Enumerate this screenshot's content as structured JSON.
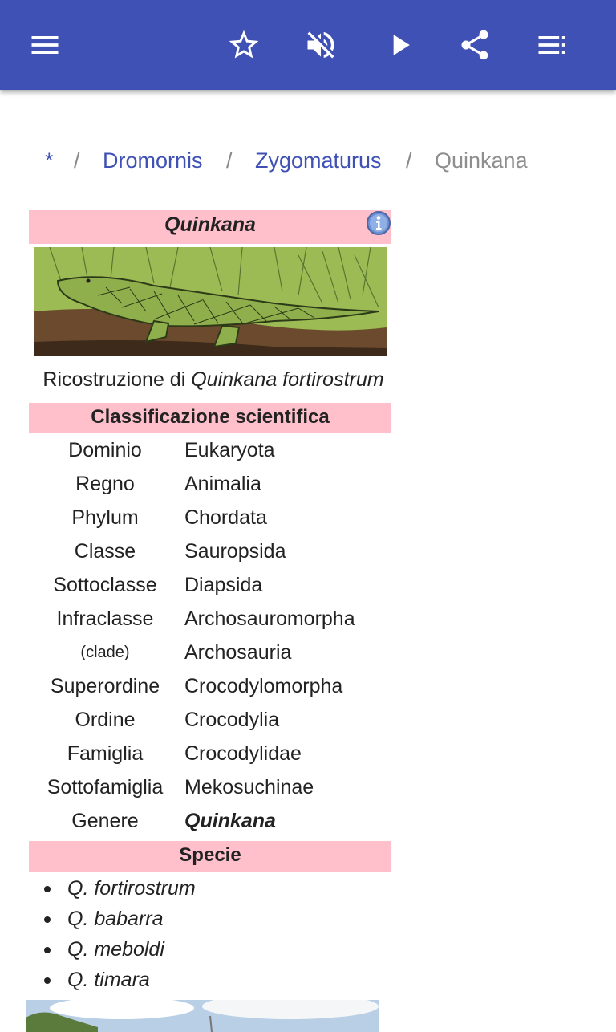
{
  "toolbar": {
    "icons": [
      "menu-icon",
      "star-outline-icon",
      "volume-off-icon",
      "play-icon",
      "share-icon",
      "playlist-icon"
    ]
  },
  "breadcrumb": {
    "items": [
      "*",
      "Dromornis",
      "Zygomaturus"
    ],
    "separator": "/",
    "current": "Quinkana"
  },
  "infobox": {
    "title": "Quinkana",
    "caption_prefix": "Ricostruzione di ",
    "caption_italic": "Quinkana fortirostrum",
    "classification_header": "Classificazione scientifica",
    "rows": [
      {
        "rank": "Dominio",
        "taxon": "Eukaryota"
      },
      {
        "rank": "Regno",
        "taxon": "Animalia"
      },
      {
        "rank": "Phylum",
        "taxon": "Chordata"
      },
      {
        "rank": "Classe",
        "taxon": "Sauropsida"
      },
      {
        "rank": "Sottoclasse",
        "taxon": "Diapsida"
      },
      {
        "rank": "Infraclasse",
        "taxon": "Archosauromorpha"
      },
      {
        "rank": "(clade)",
        "taxon": "Archosauria"
      },
      {
        "rank": "Superordine",
        "taxon": "Crocodylomorpha"
      },
      {
        "rank": "Ordine",
        "taxon": "Crocodylia"
      },
      {
        "rank": "Famiglia",
        "taxon": "Crocodylidae"
      },
      {
        "rank": "Sottofamiglia",
        "taxon": "Mekosuchinae"
      },
      {
        "rank": "Genere",
        "taxon": "Quinkana"
      }
    ],
    "species_header": "Specie",
    "species": [
      "Q. fortirostrum",
      "Q. babarra",
      "Q. meboldi",
      "Q. timara"
    ]
  },
  "colors": {
    "appbar": "#3f51b5",
    "link": "#3f51b5",
    "infobox_header": "#ffc0cb"
  }
}
